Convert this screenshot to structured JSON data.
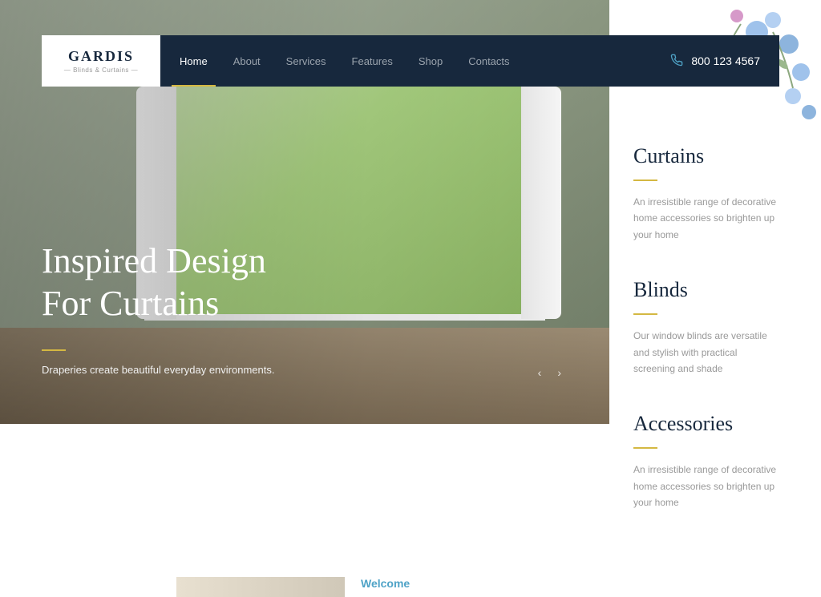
{
  "brand": {
    "name": "GARDIS",
    "tagline": "— Blinds & Curtains —"
  },
  "nav": {
    "items": [
      {
        "label": "Home",
        "active": true
      },
      {
        "label": "About",
        "active": false
      },
      {
        "label": "Services",
        "active": false
      },
      {
        "label": "Features",
        "active": false
      },
      {
        "label": "Shop",
        "active": false
      },
      {
        "label": "Contacts",
        "active": false
      }
    ],
    "phone": "800 123 4567"
  },
  "hero": {
    "title_line1": "Inspired Design",
    "title_line2": "For Curtains",
    "subtitle": "Draperies create beautiful everyday environments."
  },
  "categories": [
    {
      "title": "Curtains",
      "desc": "An irresistible range of decorative home accessories so brighten up your home"
    },
    {
      "title": "Blinds",
      "desc": "Our window blinds are versatile and stylish with practical screening and shade"
    },
    {
      "title": "Accessories",
      "desc": "An irresistible range of decorative home accessories so brighten up your home"
    }
  ],
  "welcome": {
    "label": "Welcome"
  }
}
